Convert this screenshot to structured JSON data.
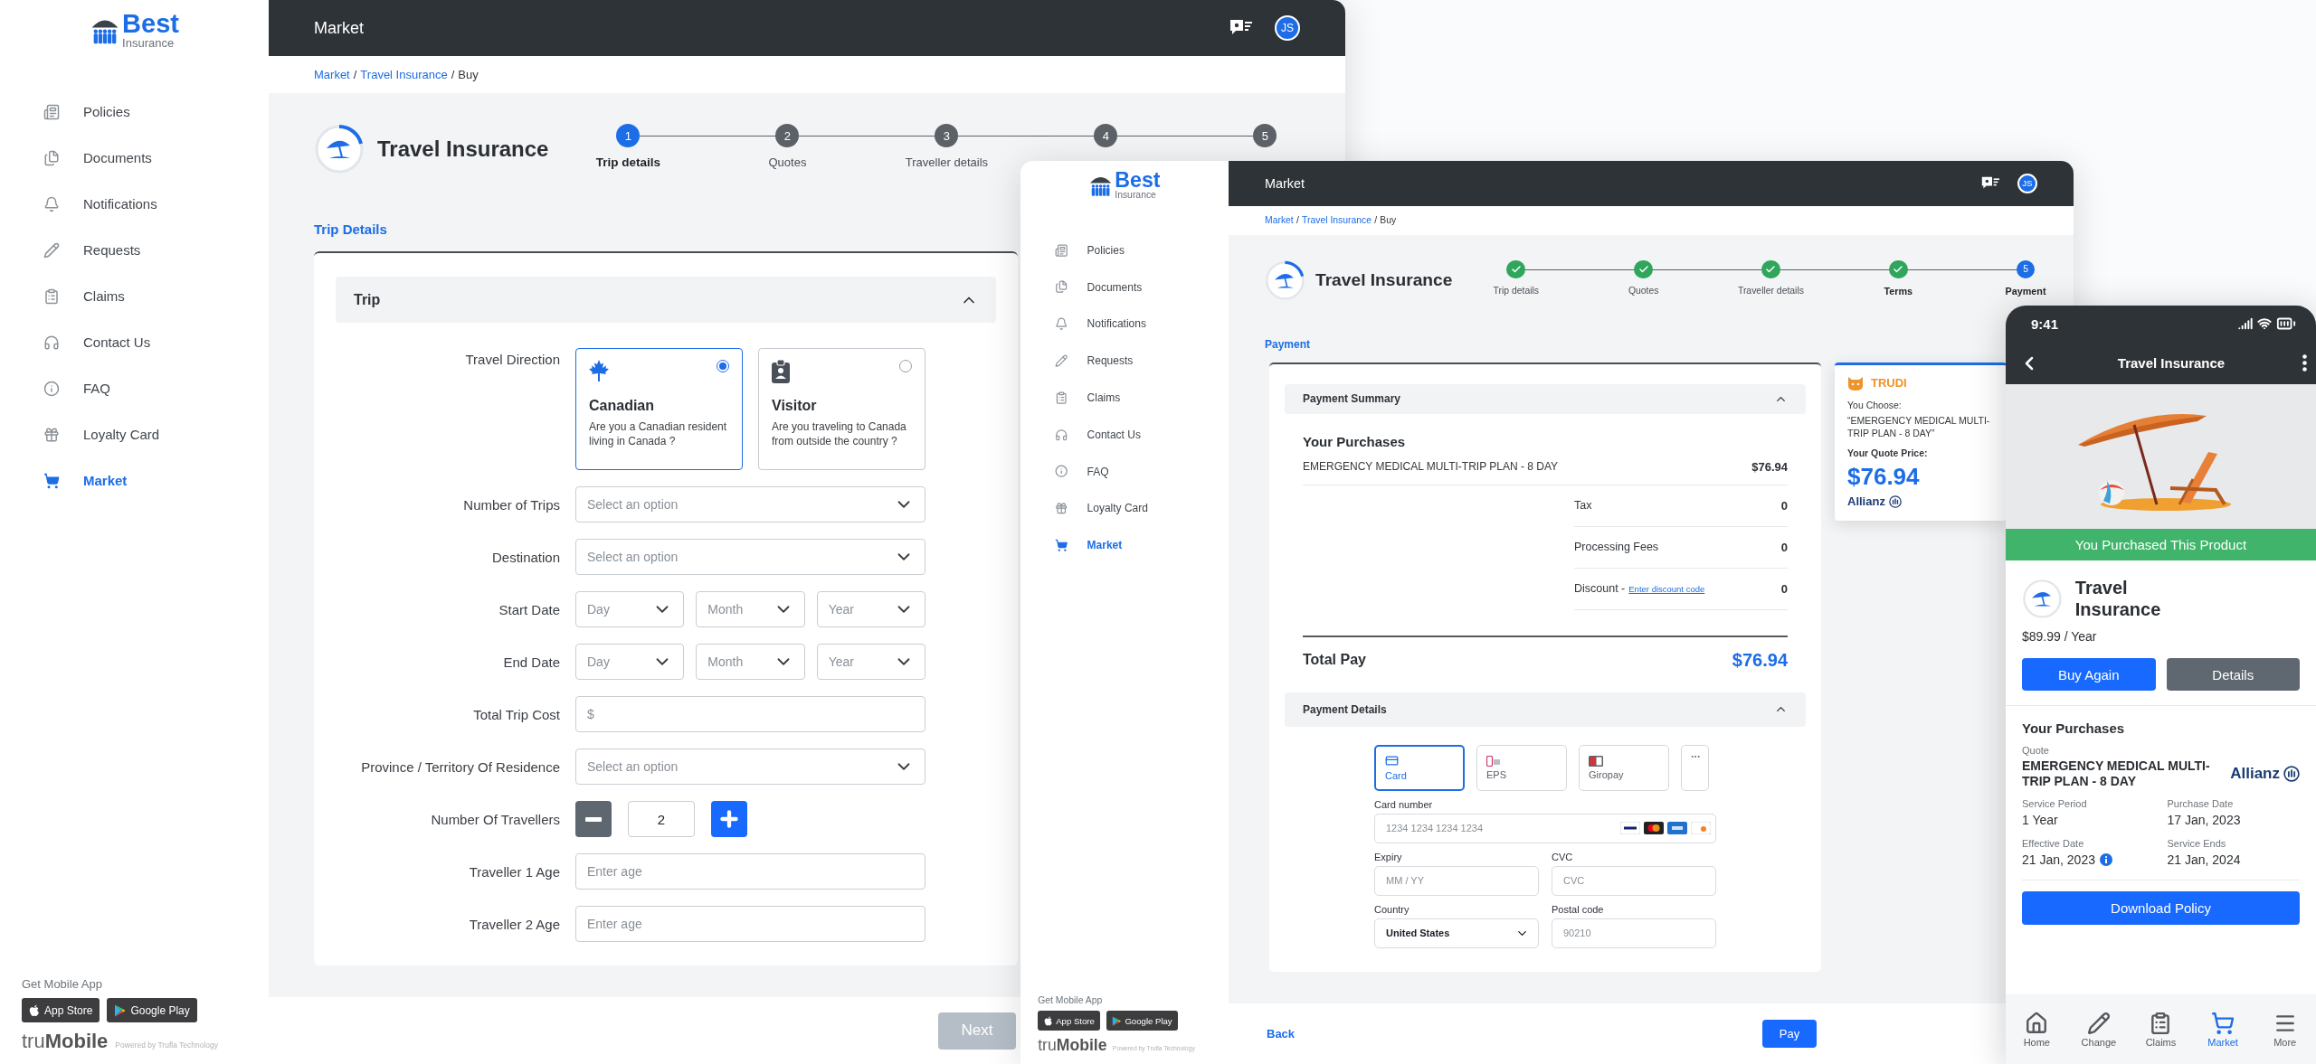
{
  "desktop_window": {
    "sidebar": {
      "logo": {
        "name": "Best",
        "tagline": "Insurance"
      },
      "items": [
        {
          "label": "Policies",
          "selected": false
        },
        {
          "label": "Documents",
          "selected": false
        },
        {
          "label": "Notifications",
          "selected": false
        },
        {
          "label": "Requests",
          "selected": false
        },
        {
          "label": "Claims",
          "selected": false
        },
        {
          "label": "Contact Us",
          "selected": false
        },
        {
          "label": "FAQ",
          "selected": false
        },
        {
          "label": "Loyalty Card",
          "selected": false
        },
        {
          "label": "Market",
          "selected": true
        }
      ],
      "mobile_app": {
        "heading": "Get Mobile App",
        "stores": [
          "App Store",
          "Google Play"
        ],
        "brand": "tru**Mobile**",
        "powered_by": "Powered by Trufla Technology"
      }
    },
    "header": {
      "title": "Market",
      "avatar": "JS"
    },
    "breadcrumb": {
      "separator": "/",
      "items": [
        {
          "label": "Market",
          "link": true
        },
        {
          "label": "Travel Insurance",
          "link": true
        },
        {
          "label": "Buy",
          "link": false
        }
      ]
    },
    "product": {
      "title": "Travel Insurance"
    },
    "steps": [
      {
        "number": "1",
        "label": "Trip details",
        "done": false,
        "selected": true,
        "bold": true
      },
      {
        "number": "2",
        "label": "Quotes",
        "done": false,
        "selected": false,
        "bold": false
      },
      {
        "number": "3",
        "label": "Traveller details",
        "done": false,
        "selected": false,
        "bold": false
      },
      {
        "number": "4",
        "done": false,
        "selected": false
      },
      {
        "number": "5",
        "done": false,
        "selected": false
      }
    ],
    "section_title": "Trip Details",
    "accordion": {
      "title": "Trip",
      "expanded": true
    },
    "travel_direction": {
      "label": "Travel Direction",
      "options": [
        {
          "title": "Canadian",
          "description": "Are you a Canadian resident living in Canada ?",
          "selected": true
        },
        {
          "title": "Visitor",
          "description": "Are you traveling to Canada from outside the country ?",
          "selected": false
        }
      ]
    },
    "fields": [
      {
        "kind": "select",
        "label": "Number of Trips",
        "placeholder": "Select an option"
      },
      {
        "kind": "select",
        "label": "Destination",
        "placeholder": "Select an option"
      },
      {
        "kind": "date",
        "label": "Start Date",
        "parts": [
          "Day",
          "Month",
          "Year"
        ]
      },
      {
        "kind": "date",
        "label": "End Date",
        "parts": [
          "Day",
          "Month",
          "Year"
        ]
      },
      {
        "kind": "text",
        "label": "Total Trip Cost",
        "placeholder": "$"
      },
      {
        "kind": "select",
        "label": "Province / Territory Of Residence",
        "placeholder": "Select an option"
      },
      {
        "kind": "counter",
        "label": "Number Of Travellers",
        "value": "2"
      },
      {
        "kind": "text",
        "label": "Traveller 1 Age",
        "placeholder": "Enter age"
      },
      {
        "kind": "text",
        "label": "Traveller 2 Age",
        "placeholder": "Enter age"
      }
    ],
    "next_button": {
      "label": "Next",
      "disabled": true
    }
  },
  "payment_window": {
    "sidebar": {
      "logo": {
        "name": "Best",
        "tagline": "Insurance"
      },
      "items": [
        {
          "label": "Policies",
          "selected": false
        },
        {
          "label": "Documents",
          "selected": false
        },
        {
          "label": "Notifications",
          "selected": false
        },
        {
          "label": "Requests",
          "selected": false
        },
        {
          "label": "Claims",
          "selected": false
        },
        {
          "label": "Contact Us",
          "selected": false
        },
        {
          "label": "FAQ",
          "selected": false
        },
        {
          "label": "Loyalty Card",
          "selected": false
        },
        {
          "label": "Market",
          "selected": true
        }
      ],
      "mobile_app": {
        "heading": "Get Mobile App",
        "stores": [
          "App Store",
          "Google Play"
        ],
        "brand": "tru**Mobile**",
        "powered_by": "Powered by Trufla Technology"
      }
    },
    "header": {
      "title": "Market",
      "avatar": "JS"
    },
    "breadcrumb": {
      "separator": "/",
      "items": [
        {
          "label": "Market",
          "link": true
        },
        {
          "label": "Travel Insurance",
          "link": true
        },
        {
          "label": "Buy",
          "link": false
        }
      ]
    },
    "product": {
      "title": "Travel Insurance"
    },
    "steps": [
      {
        "label": "Trip details",
        "done": true,
        "selected": false,
        "bold": false
      },
      {
        "label": "Quotes",
        "done": true,
        "selected": false,
        "bold": false
      },
      {
        "label": "Traveller details",
        "done": true,
        "selected": false,
        "bold": false
      },
      {
        "label": "Terms",
        "done": true,
        "selected": false,
        "bold": true
      },
      {
        "number": "5",
        "label": "Payment",
        "done": false,
        "selected": true,
        "bold": true
      }
    ],
    "section_title": "Payment",
    "summary": {
      "title": "Payment Summary",
      "expanded": true,
      "heading": "Your Purchases",
      "item": {
        "name": "EMERGENCY MEDICAL MULTI-TRIP PLAN - 8 DAY",
        "price": "$76.94"
      },
      "fees": [
        {
          "label": "Tax",
          "amount": "0"
        },
        {
          "label": "Processing Fees",
          "amount": "0"
        },
        {
          "label": "Discount -",
          "link": "Enter discount code",
          "amount": "0"
        }
      ],
      "total": {
        "label": "Total Pay",
        "amount": "$76.94"
      }
    },
    "details": {
      "title": "Payment Details",
      "expanded": true,
      "methods": [
        {
          "label": "Card",
          "selected": true
        },
        {
          "label": "EPS",
          "selected": false
        },
        {
          "label": "Giropay",
          "selected": false
        }
      ],
      "fields": [
        {
          "kind": "card",
          "label": "Card number",
          "placeholder": "1234 1234 1234 1234"
        },
        {
          "kind": "text",
          "label": "Expiry",
          "placeholder": "MM / YY"
        },
        {
          "kind": "text",
          "label": "CVC",
          "placeholder": "CVC"
        },
        {
          "kind": "select",
          "label": "Country",
          "value": "United States"
        },
        {
          "kind": "text",
          "label": "Postal code",
          "placeholder": "90210"
        }
      ]
    },
    "assistant": {
      "name": "TRUDI",
      "intro": "You Choose:",
      "choice": "“EMERGENCY MEDICAL MULTI-TRIP PLAN - 8 DAY”",
      "price_label": "Your Quote Price:",
      "price": "$76.94",
      "insurer": "Allianz"
    },
    "back_button": {
      "label": "Back"
    },
    "pay_button": {
      "label": "Pay",
      "disabled": false
    }
  },
  "phone": {
    "status_bar": {
      "time": "9:41"
    },
    "title": "Travel Insurance",
    "banner": "You Purchased This Product",
    "product": {
      "title": "Travel Insurance",
      "price": "$89.99 / Year"
    },
    "buttons": [
      {
        "label": "Buy Again",
        "kind": "primary"
      },
      {
        "label": "Details",
        "kind": "secondary"
      }
    ],
    "purchases": {
      "heading": "Your Purchases",
      "quote_label": "Quote",
      "quote": "EMERGENCY MEDICAL MULTI-TRIP PLAN - 8 DAY",
      "insurer": "Allianz",
      "facts": [
        {
          "label": "Service Period",
          "value": "1 Year",
          "info": false
        },
        {
          "label": "Purchase Date",
          "value": "17 Jan, 2023",
          "info": false
        },
        {
          "label": "Effective Date",
          "value": "21 Jan, 2023",
          "info": true
        },
        {
          "label": "Service Ends",
          "value": "21 Jan, 2024",
          "info": false
        }
      ]
    },
    "download_button": {
      "label": "Download Policy"
    },
    "tabs": [
      {
        "label": "Home",
        "selected": false
      },
      {
        "label": "Change",
        "selected": false
      },
      {
        "label": "Claims",
        "selected": false
      },
      {
        "label": "Market",
        "selected": true
      },
      {
        "label": "More",
        "selected": false
      }
    ]
  }
}
